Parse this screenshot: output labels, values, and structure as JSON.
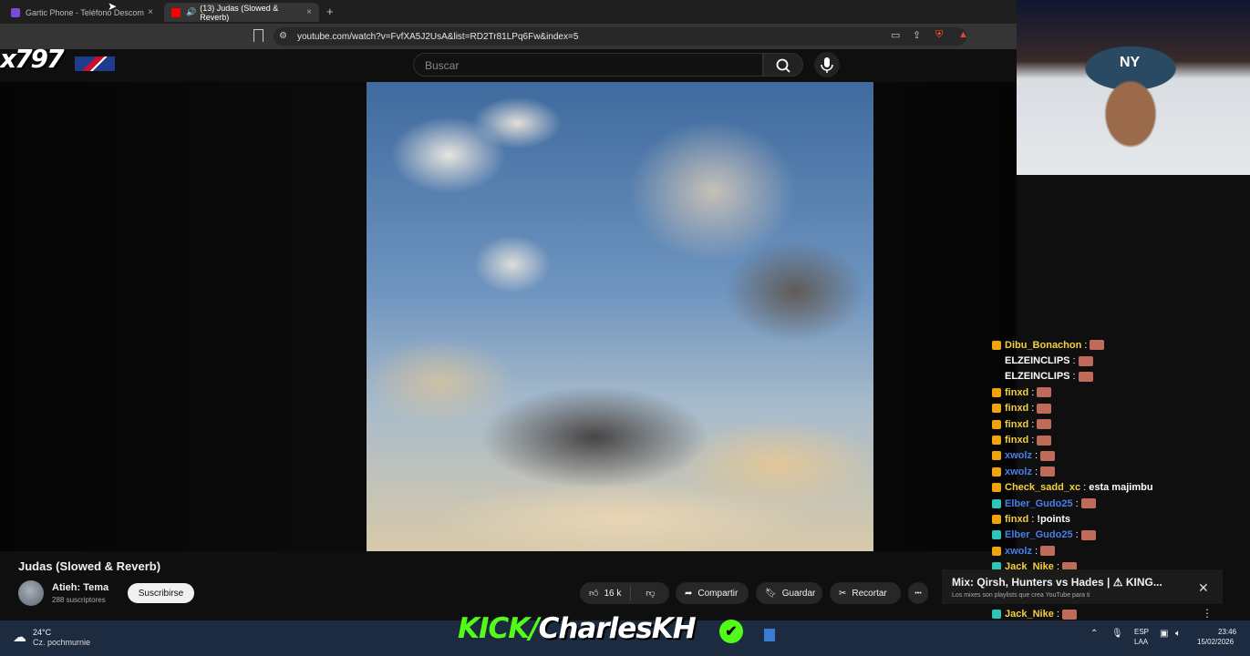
{
  "browser": {
    "tabs": [
      {
        "title": "Gartic Phone - Teléfono Descom",
        "active": false
      },
      {
        "title": "(13) Judas (Slowed & Reverb)",
        "active": true
      }
    ],
    "new_tab": "+",
    "close": "×",
    "url": "youtube.com/watch?v=FvfXA5J2UsA&list=RD2Tr81LPq6Fw&index=5"
  },
  "overlay": {
    "logo_text": "x797"
  },
  "youtube": {
    "search_placeholder": "Buscar",
    "video_title": "Judas (Slowed & Reverb)",
    "channel": "Atieh: Tema",
    "subscribers": "288 suscriptores",
    "subscribe_label": "Suscribirse",
    "likes": "16 k",
    "share_label": "Compartir",
    "save_label": "Guardar",
    "clip_label": "Recortar",
    "more_label": "•••"
  },
  "facecam": {
    "cap_logo": "NY"
  },
  "chat": [
    {
      "user": "Dibu_Bonachon",
      "color": "#f4d03f",
      "badge": "#f0a30a",
      "msg": "",
      "emote": true
    },
    {
      "user": "ELZEINCLIPS",
      "color": "#ffffff",
      "badge": "",
      "msg": "",
      "emote": true
    },
    {
      "user": "ELZEINCLIPS",
      "color": "#ffffff",
      "badge": "",
      "msg": "",
      "emote": true
    },
    {
      "user": "finxd",
      "color": "#f4d03f",
      "badge": "#f0a30a",
      "msg": "",
      "emote": true
    },
    {
      "user": "finxd",
      "color": "#f4d03f",
      "badge": "#f0a30a",
      "msg": "",
      "emote": true
    },
    {
      "user": "finxd",
      "color": "#f4d03f",
      "badge": "#f0a30a",
      "msg": "",
      "emote": true
    },
    {
      "user": "finxd",
      "color": "#f4d03f",
      "badge": "#f0a30a",
      "msg": "",
      "emote": true
    },
    {
      "user": "xwolz",
      "color": "#4a7fe8",
      "badge": "#f0a30a",
      "msg": "",
      "emote": true
    },
    {
      "user": "xwolz",
      "color": "#4a7fe8",
      "badge": "#f0a30a",
      "msg": "",
      "emote": true
    },
    {
      "user": "Check_sadd_xc",
      "color": "#f4d03f",
      "badge": "#f0a30a",
      "msg": "esta majimbu",
      "emote": false
    },
    {
      "user": "Elber_Gudo25",
      "color": "#4a7fe8",
      "badge": "#2ec4b6",
      "msg": "",
      "emote": true
    },
    {
      "user": "finxd",
      "color": "#f4d03f",
      "badge": "#f0a30a",
      "msg": "!points",
      "emote": false
    },
    {
      "user": "Elber_Gudo25",
      "color": "#4a7fe8",
      "badge": "#2ec4b6",
      "msg": "",
      "emote": true
    },
    {
      "user": "xwolz",
      "color": "#4a7fe8",
      "badge": "#f0a30a",
      "msg": "",
      "emote": true
    },
    {
      "user": "Jack_Nike",
      "color": "#f4d03f",
      "badge": "#2ec4b6",
      "msg": "",
      "emote": true
    },
    {
      "user": "Jack_Nike",
      "color": "#f4d03f",
      "badge": "#2ec4b6",
      "msg": "",
      "emote": true
    },
    {
      "user": "Jack_Nike",
      "color": "#f4d03f",
      "badge": "#2ec4b6",
      "msg": "",
      "emote": true
    },
    {
      "user": "Jack_Nike",
      "color": "#f4d03f",
      "badge": "#2ec4b6",
      "msg": "",
      "emote": true
    },
    {
      "user": "Jack_Nike",
      "color": "#f4d03f",
      "badge": "#2ec4b6",
      "msg": "",
      "emote": true
    }
  ],
  "mix_card": {
    "title": "Mix: Qirsh, Hunters vs Hades | ⚠ KING...",
    "subtitle": "Los mixes son playlists que crea YouTube para ti",
    "close": "✕",
    "more": "⋮"
  },
  "taskbar": {
    "temperature": "24°C",
    "location": "Cz. pochmurnie",
    "kick_prefix": "KICK/",
    "kick_name": "CharlesKH",
    "verified": "✔",
    "lang_top": "ESP",
    "lang_bottom": "LAA",
    "time": "23:46",
    "date": "15/02/2026"
  }
}
